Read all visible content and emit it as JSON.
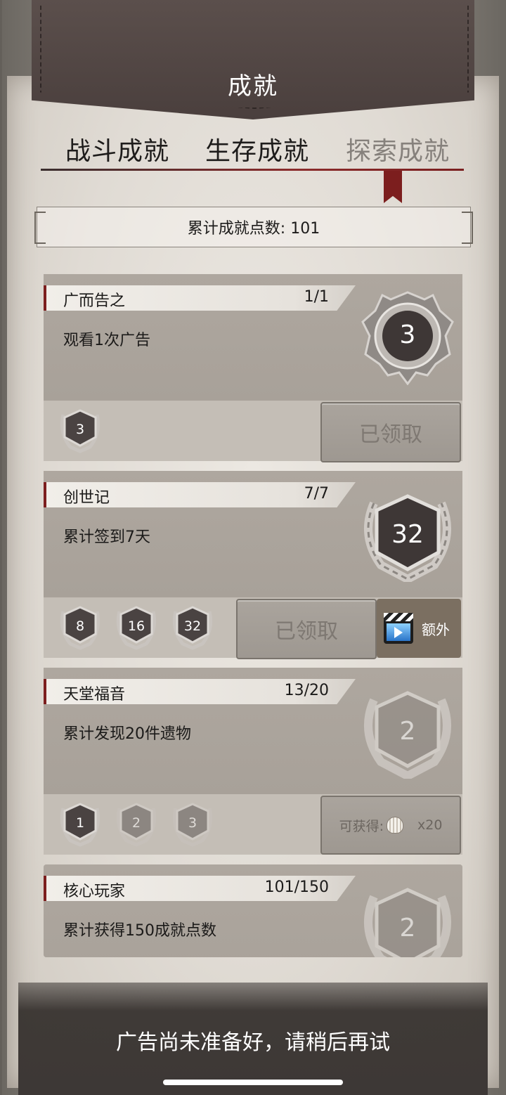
{
  "header": {
    "title": "成就"
  },
  "tabs": [
    {
      "label": "战斗成就",
      "active": false
    },
    {
      "label": "生存成就",
      "active": false
    },
    {
      "label": "探索成就",
      "active": true
    }
  ],
  "summary": {
    "text": "累计成就点数: 101"
  },
  "achievements": [
    {
      "name": "广而告之",
      "progress": "1/1",
      "desc": "观看1次广告",
      "medal_value": "3",
      "medal_style": "ornate",
      "small_medals": [
        {
          "value": "3",
          "achieved": true
        }
      ],
      "action": {
        "type": "claimed",
        "label": "已领取"
      }
    },
    {
      "name": "创世记",
      "progress": "7/7",
      "desc": "累计签到7天",
      "medal_value": "32",
      "medal_style": "laurel",
      "small_medals": [
        {
          "value": "8",
          "achieved": true
        },
        {
          "value": "16",
          "achieved": true
        },
        {
          "value": "32",
          "achieved": true
        }
      ],
      "action": {
        "type": "claimed",
        "label": "已领取"
      },
      "extra": {
        "label": "额外",
        "icon": "video-clapper-icon"
      }
    },
    {
      "name": "天堂福音",
      "progress": "13/20",
      "desc": "累计发现20件遗物",
      "medal_value": "2",
      "medal_style": "laurel-dim",
      "small_medals": [
        {
          "value": "1",
          "achieved": true
        },
        {
          "value": "2",
          "achieved": false
        },
        {
          "value": "3",
          "achieved": false
        }
      ],
      "action": {
        "type": "obtainable",
        "label": "可获得:",
        "amount": "x20",
        "icon": "shell-icon"
      }
    },
    {
      "name": "核心玩家",
      "progress": "101/150",
      "desc": "累计获得150成就点数",
      "medal_value": "2",
      "medal_style": "laurel-dim"
    }
  ],
  "toast": {
    "text": "广告尚未准备好，请稍后再试"
  },
  "colors": {
    "accent": "#7c1e1e",
    "banner": "#4e4341",
    "paper": "#e6e2dc"
  }
}
